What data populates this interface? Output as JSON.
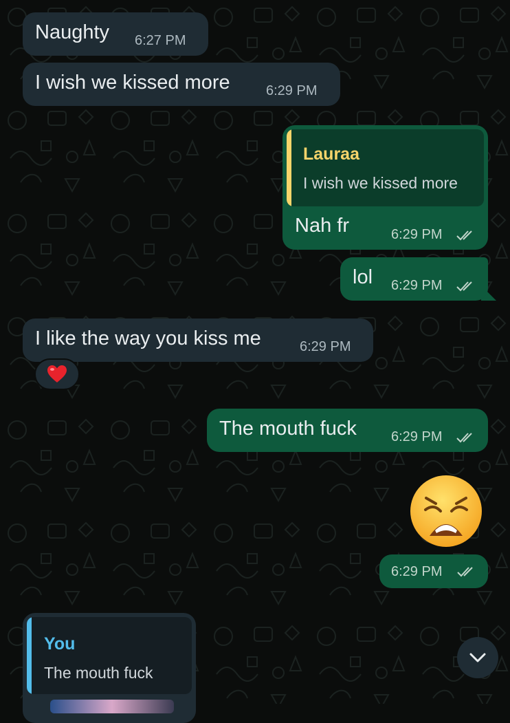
{
  "messages": [
    {
      "id": "m1",
      "direction": "incoming",
      "text": "Naughty",
      "time": "6:27 PM"
    },
    {
      "id": "m2",
      "direction": "incoming",
      "text": "I wish we kissed more",
      "time": "6:29 PM"
    },
    {
      "id": "m3",
      "direction": "outgoing",
      "text": "Nah fr",
      "time": "6:29 PM",
      "status": "read",
      "reply_to": {
        "author": "Lauraa",
        "text": "I wish we kissed more"
      }
    },
    {
      "id": "m4",
      "direction": "outgoing",
      "text": "lol",
      "time": "6:29 PM",
      "status": "read"
    },
    {
      "id": "m5",
      "direction": "incoming",
      "text": "I like the way you kiss me",
      "time": "6:29 PM",
      "reaction": "heart-emoji"
    },
    {
      "id": "m6",
      "direction": "outgoing",
      "text": "The mouth fuck",
      "time": "6:29 PM",
      "status": "read"
    },
    {
      "id": "m7",
      "direction": "outgoing",
      "emoji": "weary-face-emoji",
      "time": "6:29 PM",
      "status": "read"
    },
    {
      "id": "m8",
      "direction": "incoming",
      "reply_to": {
        "author": "You",
        "text": "The mouth fuck"
      }
    }
  ],
  "colors": {
    "background": "#0b0d0c",
    "incoming_bubble": "#1f2c34",
    "outgoing_bubble": "#0e5a3d",
    "reply_lauraa": "#f7d56b",
    "reply_you": "#53bdeb",
    "read_ticks": "#c3d6cc"
  },
  "icons": {
    "read_receipt": "double-check-icon",
    "scroll_down": "chevron-down-icon"
  }
}
